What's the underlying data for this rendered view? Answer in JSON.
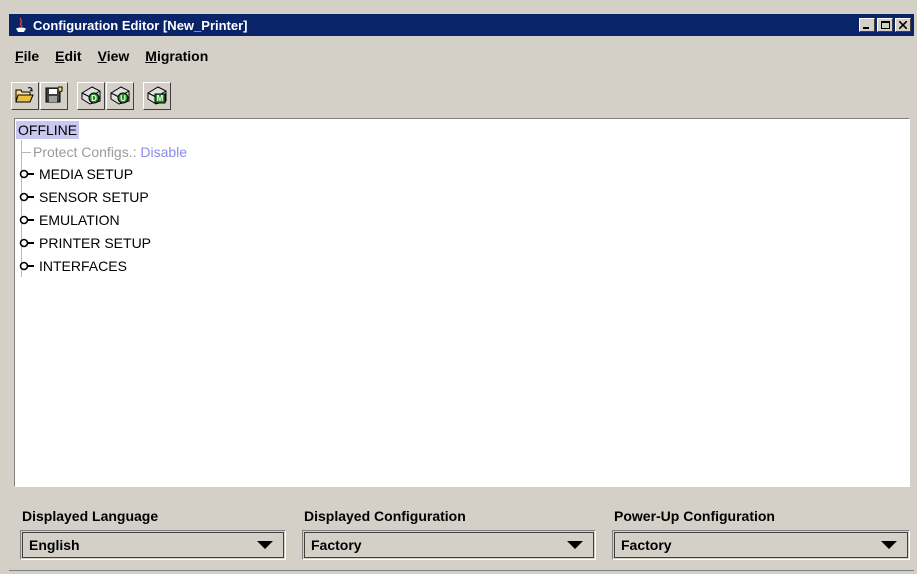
{
  "window": {
    "title": "Configuration Editor [New_Printer]",
    "controls": {
      "minimize": "_",
      "maximize": "□",
      "close": "×"
    }
  },
  "menu": {
    "items": [
      {
        "label": "File",
        "mnemonic_index": 0
      },
      {
        "label": "Edit",
        "mnemonic_index": 0
      },
      {
        "label": "View",
        "mnemonic_index": 0
      },
      {
        "label": "Migration",
        "mnemonic_index": 0
      }
    ]
  },
  "toolbar": {
    "buttons": [
      {
        "icon": "open-folder-icon"
      },
      {
        "icon": "save-disk-icon"
      },
      {
        "icon": "printer-download-icon",
        "badge": "D"
      },
      {
        "icon": "printer-upload-icon",
        "badge": "U"
      },
      {
        "icon": "printer-migrate-icon",
        "badge": "M"
      }
    ]
  },
  "tree": {
    "root": "OFFLINE",
    "leaf": {
      "label": "Protect Configs.: ",
      "value": "Disable"
    },
    "nodes": [
      "MEDIA SETUP",
      "SENSOR SETUP",
      "EMULATION",
      "PRINTER SETUP",
      "INTERFACES"
    ]
  },
  "config": {
    "language": {
      "label": "Displayed Language",
      "value": "English"
    },
    "displayed": {
      "label": "Displayed Configuration",
      "value": "Factory"
    },
    "powerup": {
      "label": "Power-Up Configuration",
      "value": "Factory"
    }
  },
  "colors": {
    "titlebar": "#0a246a",
    "selection": "#c8c8f0",
    "leaf_value": "#8a8af0",
    "chrome": "#d4d0c8"
  }
}
